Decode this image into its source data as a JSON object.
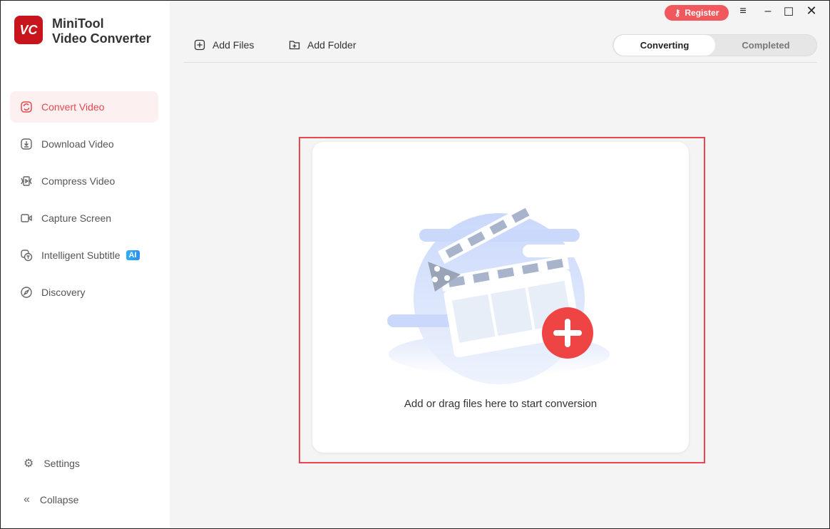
{
  "app": {
    "logo_text": "VC",
    "title_line1": "MiniTool",
    "title_line2": "Video Converter"
  },
  "sidebar": {
    "items": [
      {
        "label": "Convert Video",
        "icon": "convert-icon",
        "active": true
      },
      {
        "label": "Download Video",
        "icon": "download-icon"
      },
      {
        "label": "Compress Video",
        "icon": "compress-icon"
      },
      {
        "label": "Capture Screen",
        "icon": "camera-icon"
      },
      {
        "label": "Intelligent Subtitle",
        "icon": "subtitle-icon",
        "badge": "AI"
      },
      {
        "label": "Discovery",
        "icon": "compass-icon"
      }
    ],
    "settings": "Settings",
    "collapse": "Collapse"
  },
  "toolbar": {
    "add_files": "Add Files",
    "add_folder": "Add Folder"
  },
  "titlebar": {
    "register": "Register"
  },
  "tabs": {
    "converting": "Converting",
    "completed": "Completed"
  },
  "dropzone": {
    "text": "Add or drag files here to start conversion"
  },
  "colors": {
    "accent": "#e8484d",
    "register": "#f0585d"
  }
}
